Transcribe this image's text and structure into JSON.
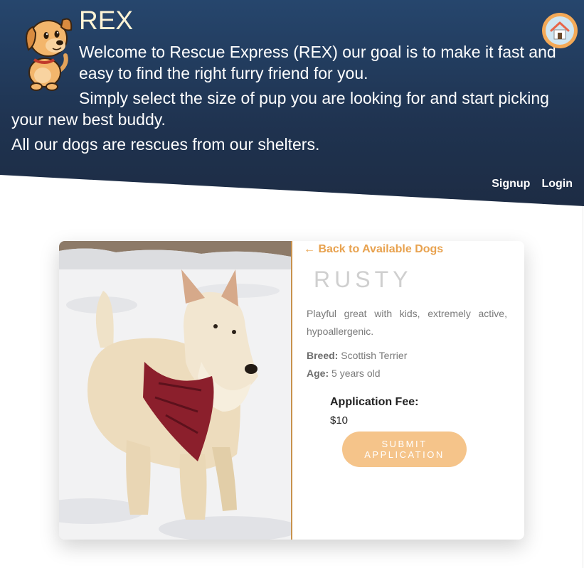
{
  "header": {
    "brand": "REX",
    "intro_1": "Welcome to Rescue Express (REX) our goal is to make it fast and easy to find the right furry friend for you.",
    "intro_2": "Simply select the size of pup you are looking for and start picking your new best buddy.",
    "intro_3": "All our dogs are rescues from our shelters.",
    "nav": {
      "signup": "Signup",
      "login": "Login"
    }
  },
  "icons": {
    "mascot": "cartoon-dog-icon",
    "home": "house-icon"
  },
  "dog": {
    "back_link": "← Back to Available Dogs",
    "name": "RUSTY",
    "description": "Playful great with kids, extremely active, hypoallergenic.",
    "breed_label": "Breed:",
    "breed": "Scottish Terrier",
    "age_label": "Age:",
    "age": "5 years old",
    "fee_label": "Application Fee:",
    "fee": "$10",
    "submit_label": "SUBMIT APPLICATION"
  },
  "colors": {
    "header_bg": "#1f3350",
    "accent": "#e8a24f",
    "button_bg": "#f5c48a"
  }
}
